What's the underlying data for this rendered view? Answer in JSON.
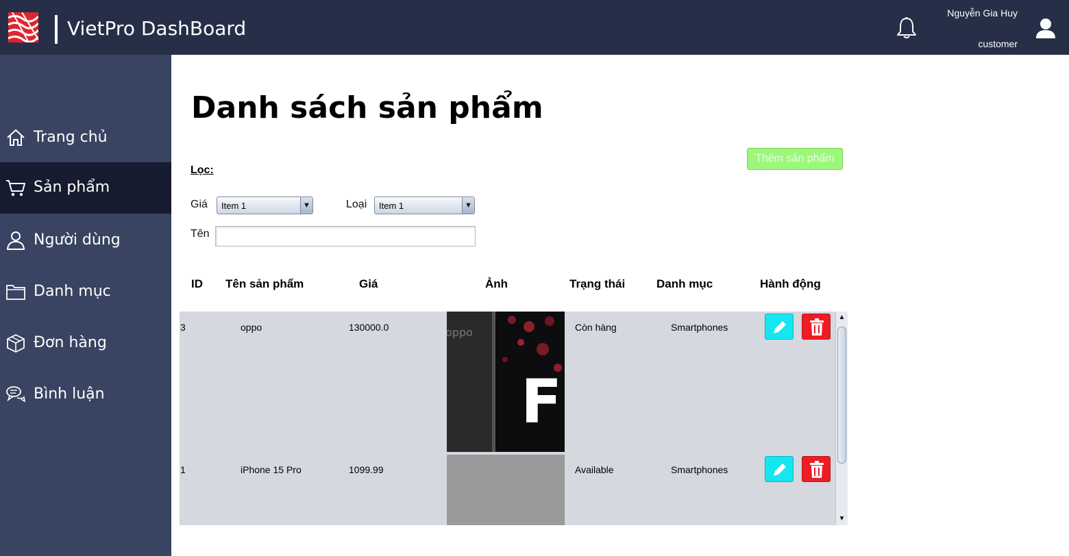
{
  "header": {
    "app_title": "VietPro DashBoard",
    "user_name": "Nguyễn Gia Huy",
    "user_role": "customer",
    "bell_icon": "bell-icon",
    "user_icon": "user-icon",
    "background_color": "#262f47"
  },
  "sidebar": {
    "background_color": "#384461",
    "active_color": "#161b2f",
    "items": [
      {
        "label": "Trang chủ",
        "icon": "home-icon",
        "active": false
      },
      {
        "label": "Sản phẩm",
        "icon": "cart-icon",
        "active": true
      },
      {
        "label": "Người dùng",
        "icon": "person-icon",
        "active": false
      },
      {
        "label": "Danh mục",
        "icon": "folder-icon",
        "active": false
      },
      {
        "label": "Đơn hàng",
        "icon": "box-icon",
        "active": false
      },
      {
        "label": "Bình luận",
        "icon": "chat-icon",
        "active": false
      }
    ]
  },
  "main": {
    "page_title": "Danh sách sản phẩm",
    "add_button": "Thêm sản phẩm",
    "filter": {
      "heading": "Lọc:",
      "price_label": "Giá",
      "price_value": "Item 1",
      "type_label": "Loại",
      "type_value": "Item 1",
      "name_label": "Tên",
      "name_value": ""
    },
    "table": {
      "headers": [
        "ID",
        "Tên sản phẩm",
        "Giá",
        "Ảnh",
        "Trạng thái",
        "Danh mục",
        "Hành động"
      ],
      "rows": [
        {
          "id": "3",
          "name": "oppo",
          "price": "130000.0",
          "image": "phone-photo",
          "status": "Còn hàng",
          "category": "Smartphones"
        },
        {
          "id": "1",
          "name": "iPhone 15 Pro",
          "price": "1099.99",
          "image": "empty",
          "status": "Available",
          "category": "Smartphones"
        }
      ]
    }
  }
}
